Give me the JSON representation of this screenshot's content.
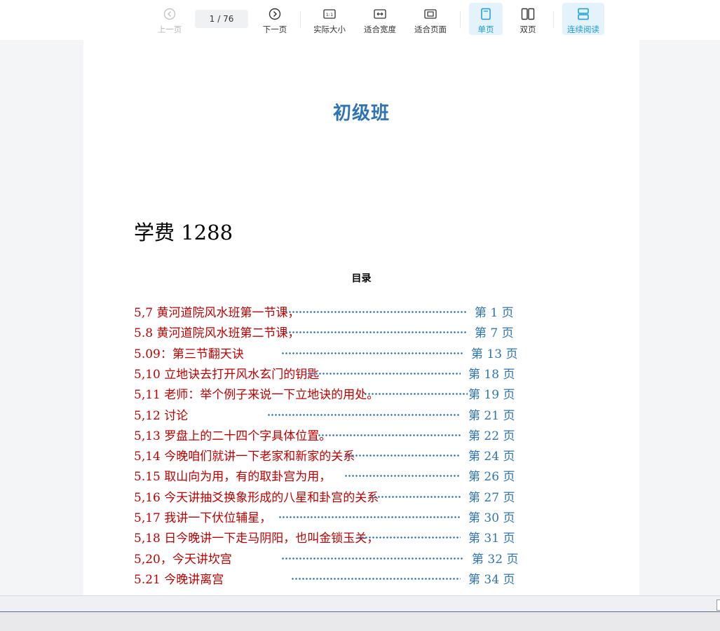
{
  "toolbar": {
    "prev_label": "上一页",
    "next_label": "下一页",
    "page_current": "1",
    "page_total": "/ 76",
    "actual_size_label": "实际大小",
    "fit_width_label": "适合宽度",
    "fit_page_label": "适合页面",
    "single_label": "单页",
    "double_label": "双页",
    "continuous_label": "连续阅读",
    "accent_color": "#1a9be0"
  },
  "document": {
    "title": "初级班",
    "fee": "学费 1288",
    "toc_heading": "目录",
    "toc": [
      {
        "label": "5,7 黄河道院风水班第一节课，",
        "page": "第 1 页"
      },
      {
        "label": "5.8 黄河道院风水班第二节课，",
        "page": "第 7 页"
      },
      {
        "label": "5.09：第三节翻天诀",
        "page": "第 13 页"
      },
      {
        "label": "5,10 立地诀去打开风水玄门的钥匙",
        "page": "第 18 页"
      },
      {
        "label": "5,11 老师：举个例子来说一下立地诀的用处。",
        "page": "第 19 页"
      },
      {
        "label": "5,12 讨论",
        "page": "第 21 页"
      },
      {
        "label": "5,13 罗盘上的二十四个字具体位置。",
        "page": "第 22 页"
      },
      {
        "label": "5,14 今晚咱们就讲一下老家和新家的关系",
        "page": "第 24 页"
      },
      {
        "label": "5.15 取山向为用，有的取卦宫为用，",
        "page": "第 26 页"
      },
      {
        "label": "5,16 今天讲抽爻换象形成的八星和卦宫的关系",
        "page": "第 27 页"
      },
      {
        "label": "5,17 我讲一下伏位辅星，",
        "page": "第 30 页"
      },
      {
        "label": "5,18 日今晚讲一下走马阴阳，也叫金锁玉关，",
        "page": "第 31 页"
      },
      {
        "label": "5,20，今天讲坎宫",
        "page": "第 32 页"
      },
      {
        "label": "5.21 今晚讲离宫",
        "page": "第 34 页"
      }
    ],
    "title_color": "#2e74b5",
    "entry_color": "#c00000"
  }
}
